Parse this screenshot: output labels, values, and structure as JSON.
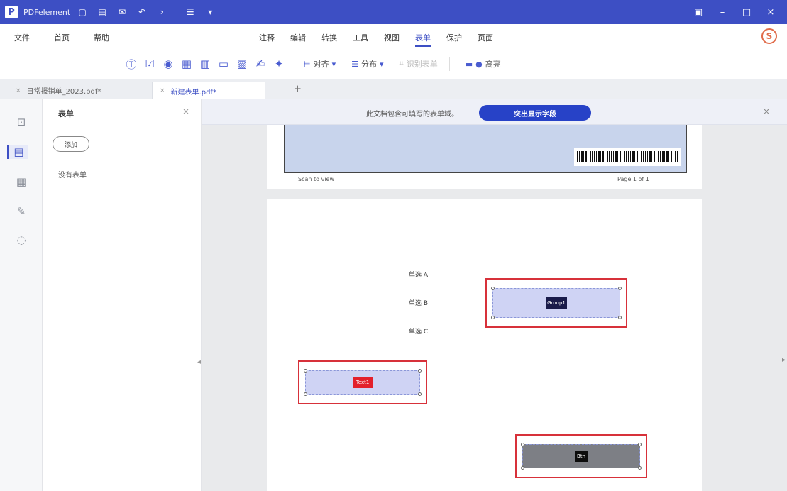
{
  "titlebar": {
    "app_name": "PDFelement",
    "icons": [
      "save-icon",
      "print-icon",
      "mail-icon",
      "undo-icon",
      "redo-icon",
      "menu-icon",
      "pin-icon"
    ],
    "window_controls": [
      "restore-icon",
      "minimize-icon",
      "maximize-icon",
      "close-icon"
    ]
  },
  "menubar": {
    "left": [
      "文件",
      "首页",
      "帮助"
    ],
    "center": [
      "注释",
      "编辑",
      "转换",
      "工具",
      "视图",
      "表单",
      "保护",
      "页面"
    ],
    "active": "表单",
    "avatar": "S"
  },
  "toolbar": {
    "tools": [
      "text-field-icon",
      "checkbox-icon",
      "radio-button-icon",
      "combo-box-icon",
      "list-box-icon",
      "button-icon",
      "image-field-icon",
      "signature-icon",
      "date-icon"
    ],
    "align_label": "对齐",
    "distribute_label": "分布",
    "recognize_label": "识别表单",
    "highlight_label": "高亮"
  },
  "tabs": [
    {
      "label": "日常报销单_2023.pdf*",
      "active": false
    },
    {
      "label": "新建表单.pdf*",
      "active": true
    }
  ],
  "new_tab_symbol": "+",
  "rail": {
    "icons": [
      "bookmark-icon",
      "forms-icon",
      "pages-icon",
      "attachment-icon",
      "search-icon"
    ]
  },
  "sidepanel": {
    "title": "表单",
    "close_symbol": "×",
    "button_label": "添加",
    "empty_text": "没有表单"
  },
  "banner": {
    "text": "此文档包含可填写的表单域。",
    "button_label": "突出显示字段",
    "close_symbol": "×"
  },
  "page1": {
    "left_caption": "Scan to view",
    "right_caption": "Page 1 of 1"
  },
  "page2": {
    "radio_labels": [
      "单选 A",
      "单选 B",
      "单选 C"
    ],
    "field1_chip": "Group1",
    "field2_chip": "Text1",
    "field3_chip": "Btn"
  },
  "colors": {
    "brand": "#3d4fc4",
    "banner_button": "#2742c7",
    "selection_red": "#d7313a",
    "field_lavender": "#cfd3f4",
    "chip_red": "#e3202b"
  }
}
